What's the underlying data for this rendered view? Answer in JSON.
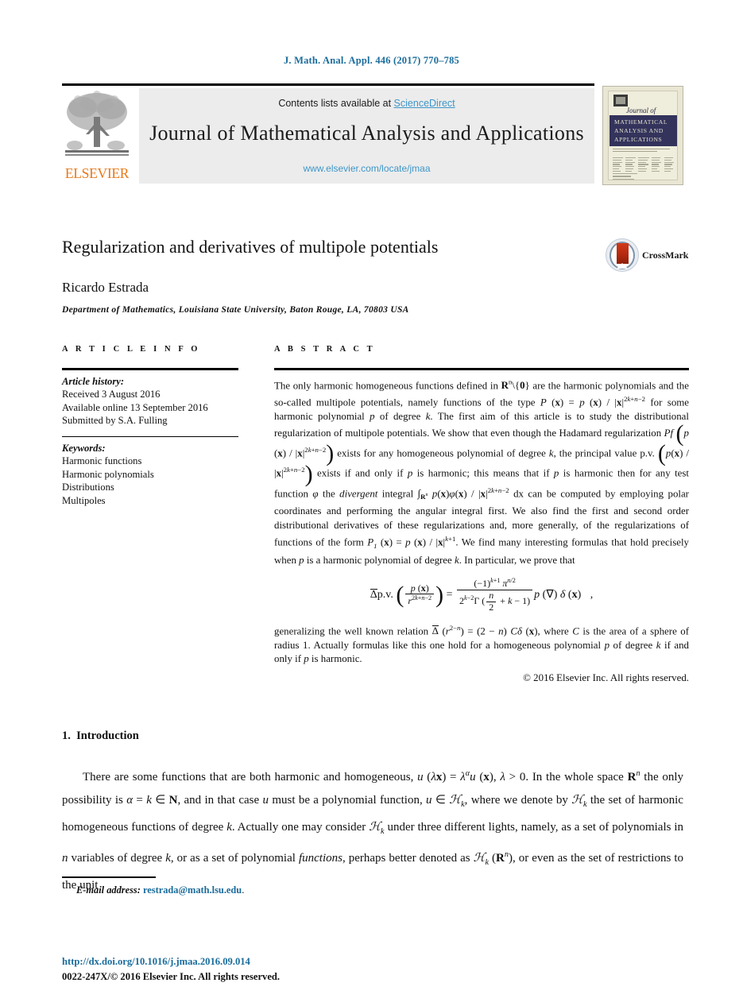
{
  "running_head": "J. Math. Anal. Appl. 446 (2017) 770–785",
  "masthead": {
    "contents_prefix": "Contents lists available at ",
    "sciencedirect": "ScienceDirect",
    "journal_title": "Journal of Mathematical Analysis and Applications",
    "journal_url": "www.elsevier.com/locate/jmaa",
    "publisher_wordmark": "ELSEVIER",
    "cover": {
      "script_line": "Journal of",
      "band_line1": "MATHEMATICAL",
      "band_line2": "ANALYSIS AND",
      "band_line3": "APPLICATIONS"
    }
  },
  "article": {
    "title": "Regularization and derivatives of multipole potentials",
    "author": "Ricardo Estrada",
    "affiliation": "Department of Mathematics, Louisiana State University, Baton Rouge, LA, 70803 USA",
    "crossmark_label": "CrossMark"
  },
  "info": {
    "heading": "A R T I C L E   I N F O",
    "history_label": "Article history:",
    "history": [
      "Received 3 August 2016",
      "Available online 13 September 2016",
      "Submitted by S.A. Fulling"
    ],
    "keywords_label": "Keywords:",
    "keywords": [
      "Harmonic functions",
      "Harmonic polynomials",
      "Distributions",
      "Multipoles"
    ]
  },
  "abstract": {
    "heading": "A B S T R A C T",
    "part1_a": "The only harmonic homogeneous functions defined in ",
    "part1_b": " are the harmonic polynomials and the so-called multipole potentials, namely functions of the type ",
    "part1_c": " for some harmonic polynomial ",
    "part1_d": " of degree ",
    "part1_e": ". The first aim of this article is to study the distributional regularization of multipole potentials. We show that even though the Hadamard regularization ",
    "part1_f": " exists for any homogeneous polynomial of degree ",
    "part1_g": ", the principal value p.v. ",
    "part1_h": " exists if and only if ",
    "part1_i": " is harmonic; this means that if ",
    "part1_j": " is harmonic then for any test function ",
    "part1_k": " the ",
    "divergent": "divergent",
    "part1_l": " integral ",
    "part1_m": " dx can be computed by employing polar coordinates and performing the angular integral first. We also find the first and second order distributional derivatives of these regularizations and, more generally, of the regularizations of functions of the form ",
    "part1_n": ". We find many interesting formulas that hold precisely when ",
    "part1_o": " is a harmonic polynomial of degree ",
    "part1_p": ". In particular, we prove that",
    "part2_a": "generalizing the well known relation ",
    "part2_b": ", where ",
    "part2_c": " is the area of a sphere of radius 1. Actually formulas like this one hold for a homogeneous polynomial ",
    "part2_d": " of degree ",
    "part2_e": " if and only if ",
    "part2_f": " is harmonic.",
    "copyright": "© 2016 Elsevier Inc. All rights reserved.",
    "equation_plain": "Δ̄ p.v. ( p(x) / r^(2k+n−2) ) = (−1)^(k+1) π^(n/2) / ( 2^(k−2) Γ(n/2 + k − 1) ) p(∇) δ(x) ,"
  },
  "body": {
    "section_number": "1.",
    "section_title": "Introduction",
    "paragraph_plain": "There are some functions that are both harmonic and homogeneous, u(λx) = λ^α u(x), λ > 0. In the whole space R^n the only possibility is α = k ∈ N, and in that case u must be a polynomial function, u ∈ H_k, where we denote by H_k the set of harmonic homogeneous functions of degree k. Actually one may consider H_k under three different lights, namely, as a set of polynomials in n variables of degree k, or as a set of polynomial functions, perhaps better denoted as H_k (R^n), or even as the set of restrictions to the unit"
  },
  "footer": {
    "email_label": "E-mail address:",
    "email": "restrada@math.lsu.edu",
    "email_period": ".",
    "doi": "http://dx.doi.org/10.1016/j.jmaa.2016.09.014",
    "issn_line": "0022-247X/© 2016 Elsevier Inc. All rights reserved."
  },
  "colors": {
    "link": "#1a6c9c",
    "sciencedirect": "#3f96c8",
    "elsevier_orange": "#e77919",
    "masthead_bg": "#ececec",
    "cover_band": "#33335c",
    "crossmark_red": "#b52a10"
  }
}
